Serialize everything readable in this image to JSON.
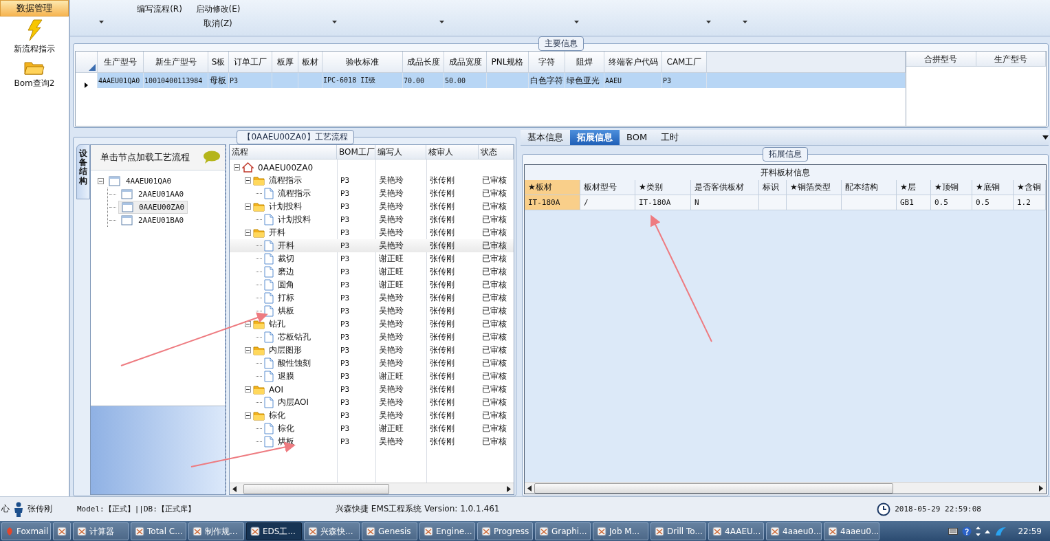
{
  "sidebar": {
    "header": "数据管理",
    "items": [
      {
        "label": "新流程指示",
        "kind": "lightning"
      },
      {
        "label": "Bom查询2",
        "kind": "folder"
      }
    ]
  },
  "toolbar": {
    "buttons": [
      {
        "label": "编写流程(R)"
      },
      {
        "label": "启动修改(E)"
      },
      {
        "label": "取消(Z)"
      }
    ]
  },
  "main_info": {
    "title": "主要信息",
    "columns": [
      "生产型号",
      "新生产型号",
      "S板",
      "订单工厂",
      "板厚",
      "板材",
      "验收标准",
      "成品长度",
      "成品宽度",
      "PNL规格",
      "字符",
      "阻焊",
      "终端客户代码",
      "CAM工厂"
    ],
    "rows": [
      {
        "selected": true,
        "cells": [
          "4AAEU01QA0",
          "10010400113984",
          "母板",
          "P3",
          "",
          "",
          "IPC-6018 II级",
          "70.00",
          "50.00",
          "",
          "白色字符",
          "绿色亚光",
          "AAEU",
          "P3"
        ]
      }
    ],
    "side_columns": [
      "合拼型号",
      "生产型号"
    ]
  },
  "process": {
    "title": "【0AAEU00ZA0】工艺流程",
    "side_tab": "设备结构",
    "hint": "单击节点加载工艺流程",
    "structure": [
      {
        "label": "4AAEU01QA0",
        "expanded": true,
        "selected": false,
        "children": [
          {
            "label": "2AAEU01AA0",
            "selected": false
          },
          {
            "label": "0AAEU00ZA0",
            "selected": true
          },
          {
            "label": "2AAEU01BA0",
            "selected": false
          }
        ]
      }
    ],
    "columns": [
      "流程",
      "BOM工厂",
      "编写人",
      "核审人",
      "状态"
    ],
    "tree": [
      {
        "label": "0AAEU00ZA0",
        "kind": "root",
        "expanded": true,
        "selected": false,
        "children": [
          {
            "label": "流程指示",
            "kind": "folder",
            "expanded": true,
            "selected": false,
            "bom": "P3",
            "writer": "吴艳玲",
            "reviewer": "张传刚",
            "status": "已审核",
            "children": [
              {
                "label": "流程指示",
                "kind": "doc",
                "selected": false,
                "bom": "P3",
                "writer": "吴艳玲",
                "reviewer": "张传刚",
                "status": "已审核"
              }
            ]
          },
          {
            "label": "计划投料",
            "kind": "folder",
            "expanded": true,
            "selected": false,
            "bom": "P3",
            "writer": "吴艳玲",
            "reviewer": "张传刚",
            "status": "已审核",
            "children": [
              {
                "label": "计划投料",
                "kind": "doc",
                "selected": false,
                "bom": "P3",
                "writer": "吴艳玲",
                "reviewer": "张传刚",
                "status": "已审核"
              }
            ]
          },
          {
            "label": "开料",
            "kind": "folder",
            "expanded": true,
            "selected": false,
            "bom": "P3",
            "writer": "吴艳玲",
            "reviewer": "张传刚",
            "status": "已审核",
            "children": [
              {
                "label": "开料",
                "kind": "doc",
                "selected": true,
                "bom": "P3",
                "writer": "吴艳玲",
                "reviewer": "张传刚",
                "status": "已审核"
              },
              {
                "label": "裁切",
                "kind": "doc",
                "selected": false,
                "bom": "P3",
                "writer": "谢正旺",
                "reviewer": "张传刚",
                "status": "已审核"
              },
              {
                "label": "磨边",
                "kind": "doc",
                "selected": false,
                "bom": "P3",
                "writer": "谢正旺",
                "reviewer": "张传刚",
                "status": "已审核"
              },
              {
                "label": "圆角",
                "kind": "doc",
                "selected": false,
                "bom": "P3",
                "writer": "谢正旺",
                "reviewer": "张传刚",
                "status": "已审核"
              },
              {
                "label": "打标",
                "kind": "doc",
                "selected": false,
                "bom": "P3",
                "writer": "吴艳玲",
                "reviewer": "张传刚",
                "status": "已审核"
              },
              {
                "label": "烘板",
                "kind": "doc",
                "selected": false,
                "bom": "P3",
                "writer": "吴艳玲",
                "reviewer": "张传刚",
                "status": "已审核"
              }
            ]
          },
          {
            "label": "钻孔",
            "kind": "folder",
            "expanded": true,
            "selected": false,
            "bom": "P3",
            "writer": "吴艳玲",
            "reviewer": "张传刚",
            "status": "已审核",
            "children": [
              {
                "label": "芯板钻孔",
                "kind": "doc",
                "selected": false,
                "bom": "P3",
                "writer": "吴艳玲",
                "reviewer": "张传刚",
                "status": "已审核"
              }
            ]
          },
          {
            "label": "内层图形",
            "kind": "folder",
            "expanded": true,
            "selected": false,
            "bom": "P3",
            "writer": "吴艳玲",
            "reviewer": "张传刚",
            "status": "已审核",
            "children": [
              {
                "label": "酸性蚀刻",
                "kind": "doc",
                "selected": false,
                "bom": "P3",
                "writer": "吴艳玲",
                "reviewer": "张传刚",
                "status": "已审核"
              },
              {
                "label": "退膜",
                "kind": "doc",
                "selected": false,
                "bom": "P3",
                "writer": "谢正旺",
                "reviewer": "张传刚",
                "status": "已审核"
              }
            ]
          },
          {
            "label": "AOI",
            "kind": "folder",
            "expanded": true,
            "selected": false,
            "bom": "P3",
            "writer": "吴艳玲",
            "reviewer": "张传刚",
            "status": "已审核",
            "children": [
              {
                "label": "内层AOI",
                "kind": "doc",
                "selected": false,
                "bom": "P3",
                "writer": "吴艳玲",
                "reviewer": "张传刚",
                "status": "已审核"
              }
            ]
          },
          {
            "label": "棕化",
            "kind": "folder",
            "expanded": true,
            "selected": false,
            "bom": "P3",
            "writer": "吴艳玲",
            "reviewer": "张传刚",
            "status": "已审核",
            "children": [
              {
                "label": "棕化",
                "kind": "doc",
                "selected": false,
                "bom": "P3",
                "writer": "谢正旺",
                "reviewer": "张传刚",
                "status": "已审核"
              },
              {
                "label": "烘板",
                "kind": "doc",
                "selected": false,
                "bom": "P3",
                "writer": "吴艳玲",
                "reviewer": "张传刚",
                "status": "已审核"
              }
            ]
          }
        ]
      }
    ]
  },
  "detail": {
    "tabs": [
      {
        "label": "基本信息",
        "selected": false
      },
      {
        "label": "拓展信息",
        "selected": true
      },
      {
        "label": "BOM",
        "selected": false
      },
      {
        "label": "工时",
        "selected": false
      }
    ],
    "group_title": "拓展信息",
    "grid_title": "开料板材信息",
    "columns": [
      {
        "label": "★板材",
        "selected": true
      },
      {
        "label": "板材型号",
        "selected": false
      },
      {
        "label": "★类别",
        "selected": false
      },
      {
        "label": "是否客供板材",
        "selected": false
      },
      {
        "label": "标识",
        "selected": false
      },
      {
        "label": "★铜箔类型",
        "selected": false
      },
      {
        "label": "配本结构",
        "selected": false
      },
      {
        "label": "★层",
        "selected": false
      },
      {
        "label": "★顶铜",
        "selected": false
      },
      {
        "label": "★底铜",
        "selected": false
      },
      {
        "label": "★含铜",
        "selected": false
      }
    ],
    "rows": [
      [
        "IT-180A",
        "/",
        "IT-180A",
        "N",
        "",
        "",
        "",
        "GB1",
        "0.5",
        "0.5",
        "1.2"
      ]
    ]
  },
  "status_bar": {
    "left": "心",
    "user": "张传刚",
    "model": "Model:【正式】||DB:【正式库】",
    "system": "兴森快捷 EMS工程系统 Version: 1.0.1.461",
    "datetime": "2018-05-29 22:59:08"
  },
  "taskbar": {
    "start": "Foxmail",
    "items": [
      {
        "selected": false
      },
      {
        "label": "计算器",
        "selected": false
      },
      {
        "label": "Total C...",
        "selected": false
      },
      {
        "label": "制作规...",
        "selected": false
      },
      {
        "label": "EDS工...",
        "selected": true
      },
      {
        "label": "兴森快...",
        "selected": false
      },
      {
        "label": "Genesis",
        "selected": false
      },
      {
        "label": "Engine...",
        "selected": false
      },
      {
        "label": "Progress",
        "selected": false
      },
      {
        "label": "Graphi...",
        "selected": false
      },
      {
        "label": "Job M...",
        "selected": false
      },
      {
        "label": "Drill To...",
        "selected": false
      },
      {
        "label": "4AAEU...",
        "selected": false
      },
      {
        "label": "4aaeu0...",
        "selected": false
      },
      {
        "label": "4aaeu0...",
        "selected": false
      }
    ],
    "clock": "22:59"
  }
}
